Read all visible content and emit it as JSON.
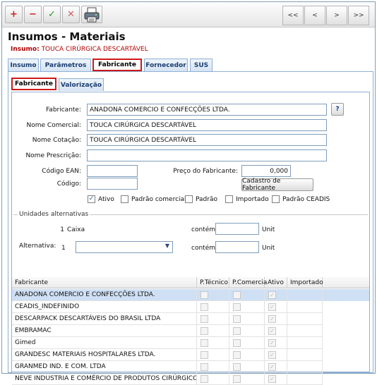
{
  "toolbar": {
    "add_glyph": "+",
    "remove_glyph": "−",
    "confirm_glyph": "✓",
    "cancel_glyph": "✕",
    "first_label": "<<",
    "prev_label": "<",
    "next_label": ">",
    "last_label": ">>"
  },
  "header": {
    "title": "Insumos - Materiais",
    "subtitle_key": "Insumo:",
    "subtitle_value": "TOUCA CIRÚRGICA DESCARTÁVEL"
  },
  "tabs": [
    "Insumo",
    "Parâmetros",
    "Fabricante",
    "Fornecedor",
    "SUS"
  ],
  "subtabs": [
    "Fabricante",
    "Valorização"
  ],
  "form": {
    "fabricante_label": "Fabricante:",
    "fabricante_value": "ANADONA COMERCIO E CONFECÇÕES LTDA.",
    "help_glyph": "?",
    "nome_comercial_label": "Nome Comercial:",
    "nome_comercial_value": "TOUCA CIRÚRGICA DESCARTÁVEL",
    "nome_cotacao_label": "Nome Cotação:",
    "nome_cotacao_value": "TOUCA CIRÚRGICA DESCARTÁVEL",
    "nome_prescricao_label": "Nome Prescrição:",
    "nome_prescricao_value": "",
    "codigo_ean_label": "Código EAN:",
    "codigo_ean_value": "",
    "codigo_label": "Código:",
    "codigo_value": "",
    "preco_label": "Preço do Fabricante:",
    "preco_value": "0,000",
    "cadastro_button": "Cadastro de Fabricante",
    "checks": [
      {
        "label": "Ativo",
        "checked": "✓"
      },
      {
        "label": "Padrão comercial",
        "checked": ""
      },
      {
        "label": "Padrão",
        "checked": ""
      },
      {
        "label": "Importado",
        "checked": ""
      },
      {
        "label": "Padrão CEADIS",
        "checked": ""
      }
    ]
  },
  "units": {
    "legend": "Unidades alternativas",
    "base_qty": "1",
    "base_unit": "Caixa",
    "contem_label": "contém",
    "unit_label": "Unit",
    "alternativa_label": "Alternativa:",
    "alt_qty": "1",
    "alt_select_value": "",
    "contem_label2": "contém",
    "unit_label2": "Unit"
  },
  "grid": {
    "headers": [
      "Fabricante",
      "P.Técnico",
      "P.Comercia",
      "Ativo",
      "Importado"
    ],
    "rows": [
      "ANADONA COMERCIO E CONFECÇÕES LTDA.",
      "CEADIS_INDEFINIDO",
      "DESCARPACK DESCARTÁVEIS DO BRASIL LTDA",
      "EMBRAMAC",
      "Gimed",
      "GRANDESC MATERIAIS HOSPITALARES LTDA.",
      "GRANMED IND. E COM. LTDA",
      "NEVE INDUSTRIA E COMÉRCIO DE PRODUTOS CIRÚRGICOS LTDA"
    ],
    "selected_color": "#cfe0f5",
    "check_glyph": "✓"
  },
  "colors": {
    "add": "#d02020",
    "remove": "#d02020",
    "confirm": "#2a9a2a",
    "cancel": "#d06060",
    "highlight": "#d01818"
  }
}
